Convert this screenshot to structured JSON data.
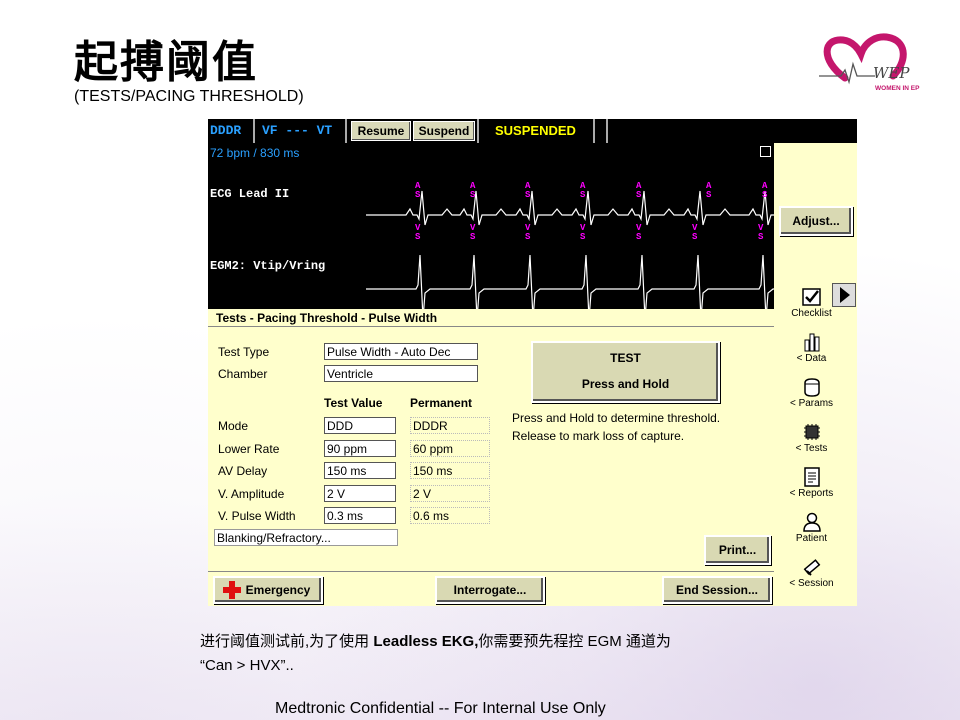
{
  "slide": {
    "title": "起搏阈值",
    "subtitle": "(TESTS/PACING THRESHOLD)",
    "logo_text": "WOMEN IN EP",
    "caption_pre": "进行阈值测试前,为了使用 ",
    "caption_bold": "Leadless EKG,",
    "caption_post": "你需要预先程控 EGM 通道为",
    "caption_line2": "“Can > HVX”..",
    "footer": "Medtronic Confidential -- For Internal Use Only"
  },
  "topbar": {
    "mode": "DDDR",
    "zone": "VF --- VT",
    "resume_label": "Resume",
    "suspend_label": "Suspend",
    "status": "SUSPENDED"
  },
  "ecg": {
    "rate": "72 bpm / 830 ms",
    "lead1_label": "ECG Lead II",
    "lead2_label": "EGM2: Vtip/Vring",
    "marker_top": "A S",
    "marker_bottom": "V S"
  },
  "buttons": {
    "adjust": "Adjust...",
    "print": "Print...",
    "emergency": "Emergency",
    "interrogate": "Interrogate...",
    "end_session": "End Session...",
    "test_line1": "TEST",
    "test_line2": "Press and Hold"
  },
  "sidebar": {
    "items": [
      "Checklist",
      "< Data",
      "< Params",
      "< Tests",
      "< Reports",
      "Patient",
      "< Session"
    ]
  },
  "panel": {
    "title": "Tests  -  Pacing Threshold  -  Pulse Width",
    "test_type_label": "Test Type",
    "test_type_value": "Pulse Width - Auto Dec",
    "chamber_label": "Chamber",
    "chamber_value": "Ventricle",
    "col_test": "Test Value",
    "col_perm": "Permanent",
    "rows": [
      {
        "label": "Mode",
        "test": "DDD",
        "perm": "DDDR"
      },
      {
        "label": "Lower Rate",
        "test": "90 ppm",
        "perm": "60 ppm"
      },
      {
        "label": "AV Delay",
        "test": "150 ms",
        "perm": "150 ms"
      },
      {
        "label": "V. Amplitude",
        "test": "2 V",
        "perm": "2 V"
      },
      {
        "label": "V. Pulse Width",
        "test": "0.3 ms",
        "perm": "0.6 ms"
      }
    ],
    "blanking": "Blanking/Refractory...",
    "info_line1": "Press and Hold to determine threshold.",
    "info_line2": "Release to mark loss of capture."
  },
  "colors": {
    "screen_bg": "#ffffcc",
    "status_yellow": "#ffff00",
    "topbar_blue": "#2aa0ff",
    "marker_magenta": "#ff00ff"
  }
}
